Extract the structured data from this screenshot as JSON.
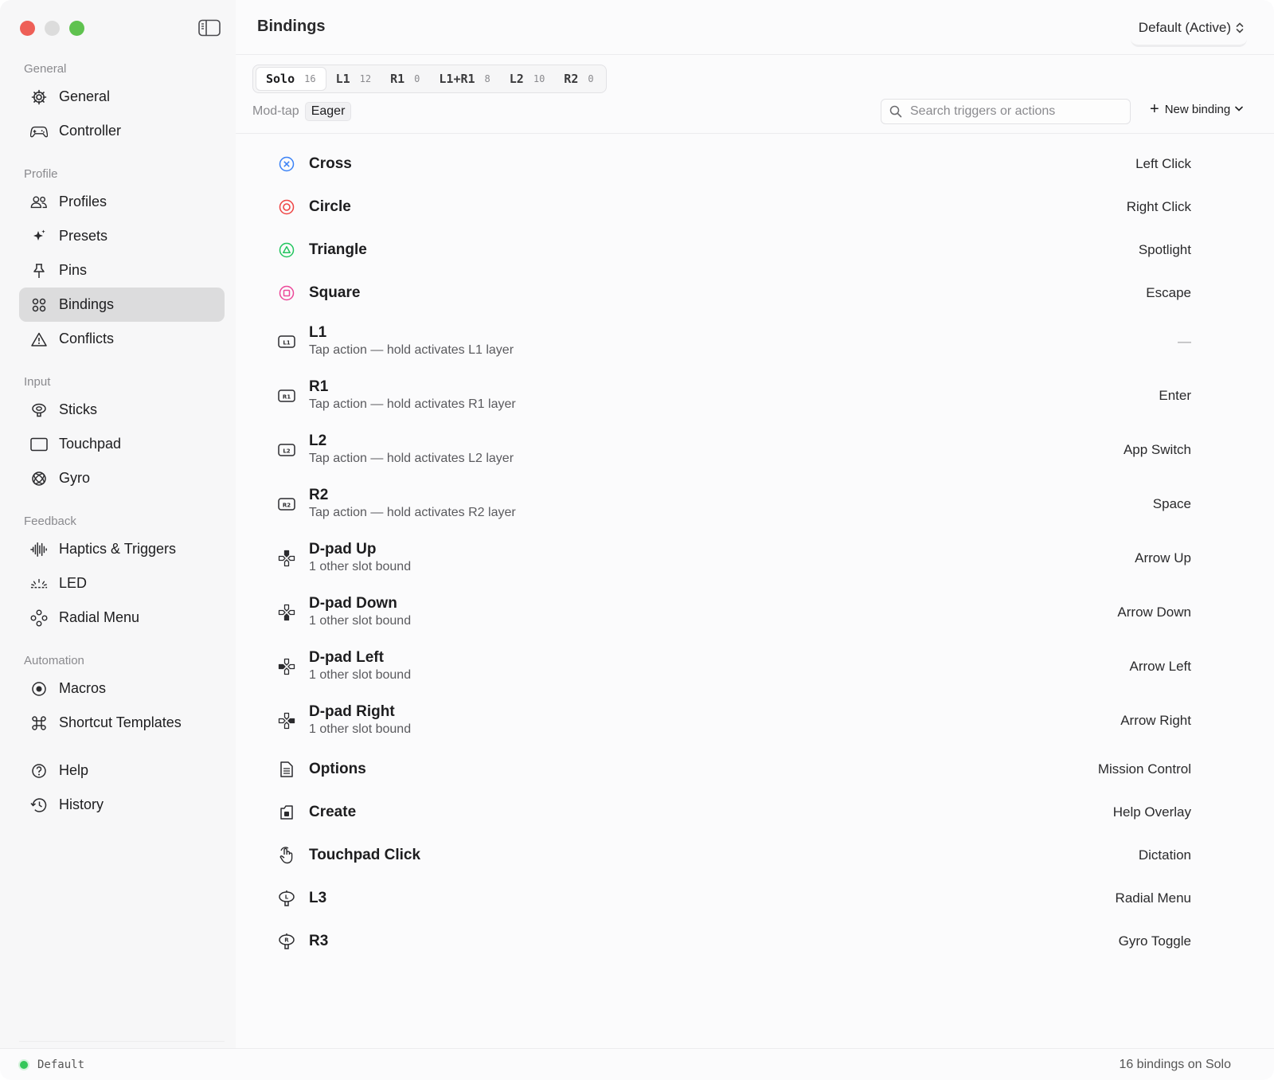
{
  "window": {
    "title": "Bindings"
  },
  "sidebar": {
    "sections": [
      {
        "label": "General",
        "items": [
          {
            "label": "General",
            "icon": "gear-icon"
          },
          {
            "label": "Controller",
            "icon": "gamepad-icon"
          }
        ]
      },
      {
        "label": "Profile",
        "items": [
          {
            "label": "Profiles",
            "icon": "people-icon"
          },
          {
            "label": "Presets",
            "icon": "sparkle-icon"
          },
          {
            "label": "Pins",
            "icon": "pin-icon"
          },
          {
            "label": "Bindings",
            "icon": "grid-icon",
            "active": true
          },
          {
            "label": "Conflicts",
            "icon": "warning-icon"
          }
        ]
      },
      {
        "label": "Input",
        "items": [
          {
            "label": "Sticks",
            "icon": "stick-icon"
          },
          {
            "label": "Touchpad",
            "icon": "touchpad-icon"
          },
          {
            "label": "Gyro",
            "icon": "gyro-icon"
          }
        ]
      },
      {
        "label": "Feedback",
        "items": [
          {
            "label": "Haptics & Triggers",
            "icon": "waveform-icon"
          },
          {
            "label": "LED",
            "icon": "led-icon"
          },
          {
            "label": "Radial Menu",
            "icon": "radial-icon"
          }
        ]
      },
      {
        "label": "Automation",
        "items": [
          {
            "label": "Macros",
            "icon": "record-icon"
          },
          {
            "label": "Shortcut Templates",
            "icon": "command-icon"
          }
        ]
      }
    ],
    "extra": [
      {
        "label": "Help",
        "icon": "help-icon"
      },
      {
        "label": "History",
        "icon": "history-icon"
      }
    ]
  },
  "header": {
    "title": "Bindings",
    "profile_select": "Default (Active)"
  },
  "tabs": [
    {
      "label": "Solo",
      "count": "16",
      "active": true
    },
    {
      "label": "L1",
      "count": "12"
    },
    {
      "label": "R1",
      "count": "0"
    },
    {
      "label": "L1+R1",
      "count": "8"
    },
    {
      "label": "L2",
      "count": "10"
    },
    {
      "label": "R2",
      "count": "0"
    }
  ],
  "modtap": {
    "label": "Mod-tap",
    "value": "Eager"
  },
  "search": {
    "placeholder": "Search triggers or actions",
    "value": ""
  },
  "new_binding": {
    "label": "New binding"
  },
  "bindings": [
    {
      "name": "Cross",
      "sub": "",
      "action": "Left Click",
      "icon": "cross-icon"
    },
    {
      "name": "Circle",
      "sub": "",
      "action": "Right Click",
      "icon": "circle-icon"
    },
    {
      "name": "Triangle",
      "sub": "",
      "action": "Spotlight",
      "icon": "triangle-icon"
    },
    {
      "name": "Square",
      "sub": "",
      "action": "Escape",
      "icon": "square-icon"
    },
    {
      "name": "L1",
      "sub": "Tap action — hold activates L1 layer",
      "action": "—",
      "icon": "l1-icon"
    },
    {
      "name": "R1",
      "sub": "Tap action — hold activates R1 layer",
      "action": "Enter",
      "icon": "r1-icon"
    },
    {
      "name": "L2",
      "sub": "Tap action — hold activates L2 layer",
      "action": "App Switch",
      "icon": "l2-icon"
    },
    {
      "name": "R2",
      "sub": "Tap action — hold activates R2 layer",
      "action": "Space",
      "icon": "r2-icon"
    },
    {
      "name": "D-pad Up",
      "sub": "1 other slot bound",
      "action": "Arrow Up",
      "icon": "dpad-up-icon"
    },
    {
      "name": "D-pad Down",
      "sub": "1 other slot bound",
      "action": "Arrow Down",
      "icon": "dpad-down-icon"
    },
    {
      "name": "D-pad Left",
      "sub": "1 other slot bound",
      "action": "Arrow Left",
      "icon": "dpad-left-icon"
    },
    {
      "name": "D-pad Right",
      "sub": "1 other slot bound",
      "action": "Arrow Right",
      "icon": "dpad-right-icon"
    },
    {
      "name": "Options",
      "sub": "",
      "action": "Mission Control",
      "icon": "options-icon"
    },
    {
      "name": "Create",
      "sub": "",
      "action": "Help Overlay",
      "icon": "create-icon"
    },
    {
      "name": "Touchpad Click",
      "sub": "",
      "action": "Dictation",
      "icon": "touchpad-click-icon"
    },
    {
      "name": "L3",
      "sub": "",
      "action": "Radial Menu",
      "icon": "l3-icon"
    },
    {
      "name": "R3",
      "sub": "",
      "action": "Gyro Toggle",
      "icon": "r3-icon"
    }
  ],
  "status": {
    "profile": "Default",
    "summary": "16 bindings on Solo"
  },
  "colors": {
    "cross": "#3b82f6",
    "circle": "#ef4444",
    "triangle": "#22c55e",
    "square": "#ec4899",
    "status_dot": "#34c759"
  }
}
